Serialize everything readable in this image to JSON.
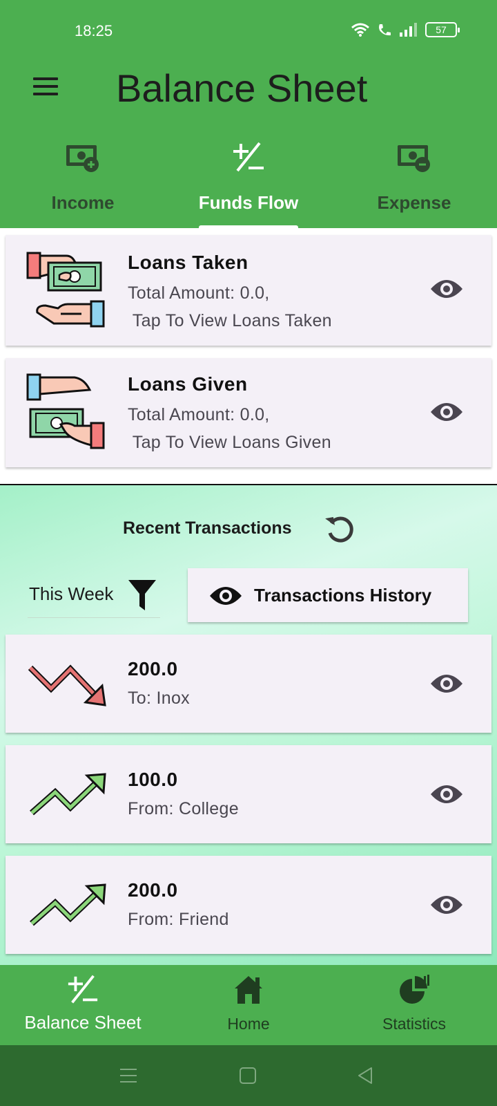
{
  "status_bar": {
    "time": "18:25",
    "battery": "57"
  },
  "app": {
    "title": "Balance Sheet"
  },
  "tabs": [
    {
      "label": "Income",
      "icon": "money-plus-icon"
    },
    {
      "label": "Funds Flow",
      "icon": "plus-minus-icon",
      "active": true
    },
    {
      "label": "Expense",
      "icon": "money-minus-icon"
    }
  ],
  "loan_cards": [
    {
      "title": "Loans Taken",
      "amount_line": "Total Amount: 0.0,",
      "hint": " Tap To View Loans Taken",
      "icon": "loans-taken-icon"
    },
    {
      "title": "Loans Given",
      "amount_line": "Total Amount: 0.0,",
      "hint": " Tap To View Loans Given",
      "icon": "loans-given-icon"
    }
  ],
  "recent": {
    "title": "Recent Transactions",
    "filter": "This Week",
    "history_button": "Transactions History"
  },
  "transactions": [
    {
      "amount": "200.0",
      "party": "To: Inox",
      "direction": "down",
      "color": "#e57373"
    },
    {
      "amount": "100.0",
      "party": "From: College",
      "direction": "up",
      "color": "#8bd67a"
    },
    {
      "amount": "200.0",
      "party": "From: Friend",
      "direction": "up",
      "color": "#8bd67a"
    }
  ],
  "bottom_nav": [
    {
      "label": "Balance Sheet",
      "icon": "plus-minus-icon",
      "active": true
    },
    {
      "label": "Home",
      "icon": "home-icon"
    },
    {
      "label": "Statistics",
      "icon": "pie-chart-icon"
    }
  ],
  "colors": {
    "primary": "#4caf50",
    "card": "#f4f0f7",
    "system_nav": "#2d6a2f"
  }
}
